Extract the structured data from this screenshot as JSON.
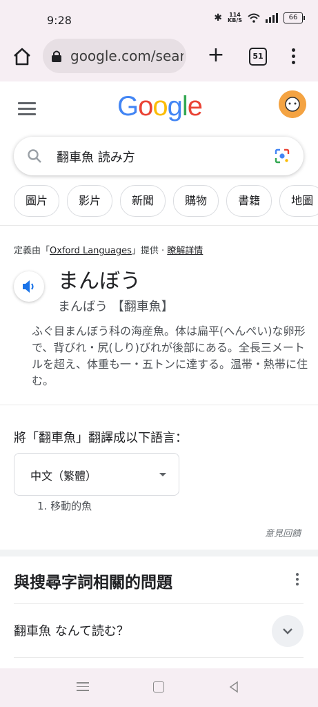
{
  "status_bar": {
    "time": "9:28",
    "net_speed": "114",
    "net_unit": "KB/S",
    "battery": "66"
  },
  "browser": {
    "url": "google.com/search",
    "tab_count": "51"
  },
  "search": {
    "query": "翻車魚 読み方"
  },
  "chips": [
    "圖片",
    "影片",
    "新聞",
    "購物",
    "書籍",
    "地圖"
  ],
  "dictionary": {
    "source_prefix": "定義由「",
    "source_name": "Oxford Languages",
    "source_suffix": "」提供 · ",
    "details_link": "瞭解詳情",
    "headword": "まんぼう",
    "reading": "まんばう 【翻車魚】",
    "definition": "ふぐ目まんぼう科の海産魚。体は扁平(へんぺい)な卵形で、背びれ・尻(しり)びれが後部にある。全長三メートルを超え、体重も一・五トンに達する。温帯・熱帯に住む。"
  },
  "translation": {
    "title": "將「翻車魚」翻譯成以下語言：",
    "language": "中文（繁體）",
    "result": "1. 移動的魚",
    "feedback": "意見回饋"
  },
  "related_questions": {
    "title": "與搜尋字詞相關的問題",
    "first_question": "翻車魚 なんて読む？"
  },
  "colors": {
    "chrome_bg": "#f6eef3",
    "link_blue": "#1a73e8",
    "speaker_blue": "#1a73e8"
  }
}
